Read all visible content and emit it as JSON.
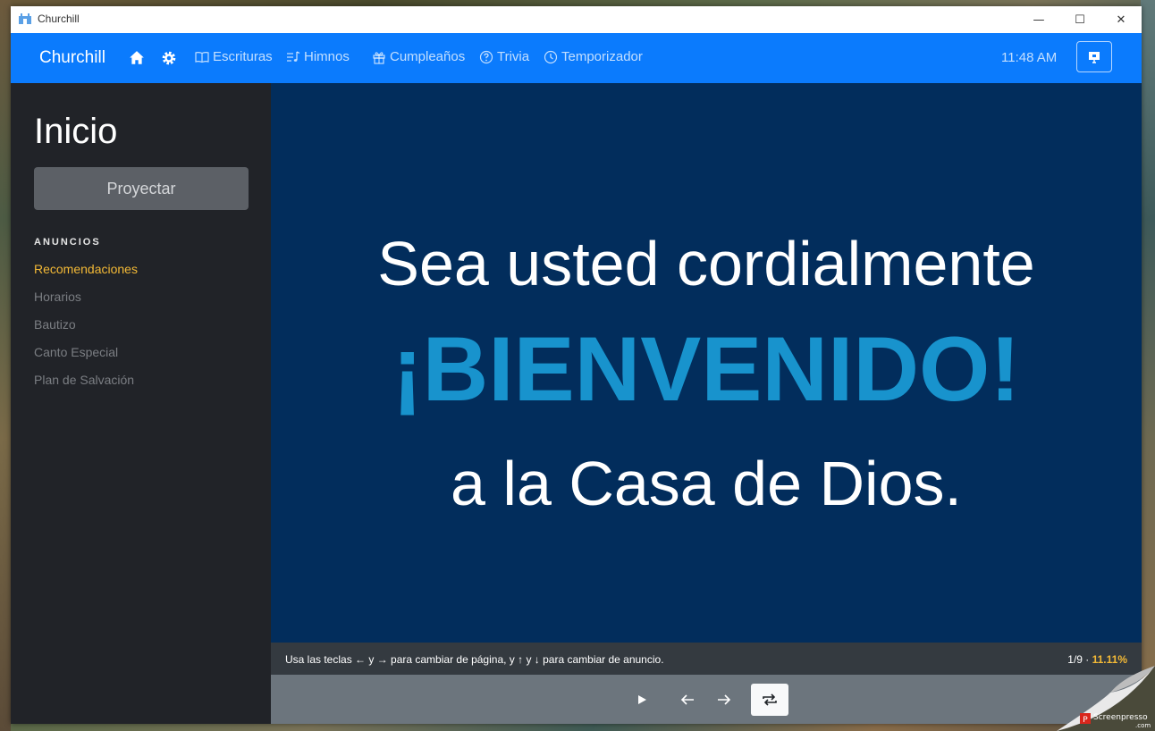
{
  "window": {
    "title": "Churchill",
    "controls": {
      "minimize": "—",
      "maximize": "☐",
      "close": "✕"
    }
  },
  "navbar": {
    "brand": "Churchill",
    "home_icon": "home-icon",
    "settings_icon": "gear-icon",
    "items": [
      {
        "label": "Escrituras",
        "icon": "book-icon"
      },
      {
        "label": "Himnos",
        "icon": "music-list-icon"
      },
      {
        "label": "Cumpleaños",
        "icon": "gift-icon"
      },
      {
        "label": "Trivia",
        "icon": "question-circle-icon"
      },
      {
        "label": "Temporizador",
        "icon": "clock-icon"
      }
    ],
    "clock": "11:48 AM",
    "project_icon": "presentation-icon"
  },
  "sidebar": {
    "title": "Inicio",
    "project_button": "Proyectar",
    "section": "ANUNCIOS",
    "items": [
      {
        "label": "Recomendaciones",
        "active": true
      },
      {
        "label": "Horarios",
        "active": false
      },
      {
        "label": "Bautizo",
        "active": false
      },
      {
        "label": "Canto Especial",
        "active": false
      },
      {
        "label": "Plan de Salvación",
        "active": false
      }
    ]
  },
  "slide": {
    "line1": "Sea usted cordialmente",
    "line2": "¡BIENVENIDO!",
    "line3": "a la Casa de Dios.",
    "background": "#022d5c",
    "accent": "#1893cd"
  },
  "status": {
    "hint": "Usa las teclas ← y → para cambiar de página, y ↑ y ↓ para cambiar de anuncio.",
    "page": "1/9 · ",
    "percent": "11.11%"
  },
  "controls": {
    "play_icon": "play-icon",
    "prev_icon": "arrow-left-icon",
    "next_icon": "arrow-right-icon",
    "loop_icon": "repeat-icon"
  },
  "watermark": {
    "brand": "Screenpresso",
    "suffix": ".com"
  }
}
